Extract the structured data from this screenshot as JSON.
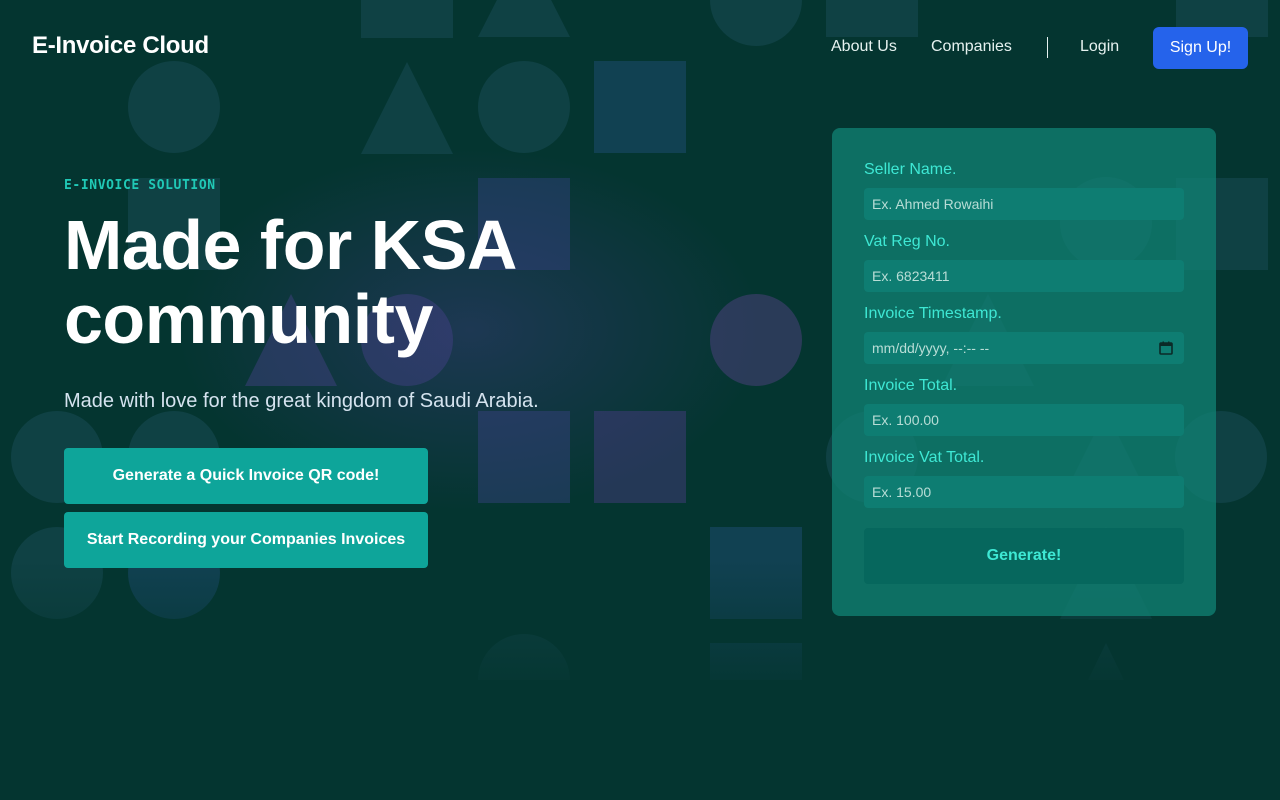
{
  "brand": {
    "name": "E-Invoice Cloud"
  },
  "nav": {
    "about": "About Us",
    "companies": "Companies",
    "login": "Login",
    "signup": "Sign Up!"
  },
  "hero": {
    "eyebrow": "E-INVOICE SOLUTION",
    "title_line1": "Made for KSA",
    "title_line2": "community",
    "subtitle": "Made with love for the great kingdom of Saudi Arabia.",
    "cta_primary": "Generate a Quick Invoice QR code!",
    "cta_secondary": "Start Recording your Companies Invoices"
  },
  "form": {
    "fields": [
      {
        "label": "Seller Name.",
        "placeholder": "Ex. Ahmed Rowaihi",
        "value": ""
      },
      {
        "label": "Vat Reg No.",
        "placeholder": "Ex. 6823411",
        "value": ""
      },
      {
        "label": "Invoice Timestamp.",
        "placeholder": "mm/dd/yyyy, --:-- --",
        "value": ""
      },
      {
        "label": "Invoice Total.",
        "placeholder": "Ex. 100.00",
        "value": ""
      },
      {
        "label": "Invoice Vat Total.",
        "placeholder": "Ex. 15.00",
        "value": ""
      }
    ],
    "submit": "Generate!"
  },
  "icons": {
    "calendar": "calendar-icon"
  },
  "colors": {
    "background": "#043530",
    "accent": "#20c9b6",
    "primary_button": "#2563eb",
    "cta_button": "#0ea59a",
    "form_card": "#118072"
  }
}
